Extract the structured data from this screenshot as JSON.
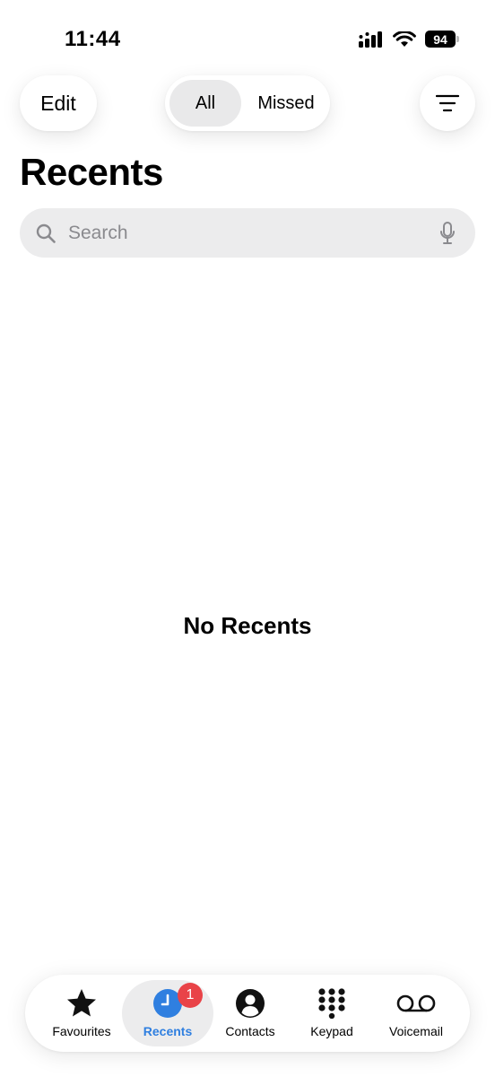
{
  "status_bar": {
    "time": "11:44",
    "battery_level": "94",
    "icons": [
      "signal-icon",
      "wifi-icon",
      "battery-icon"
    ]
  },
  "header": {
    "edit_label": "Edit",
    "segments": [
      {
        "label": "All",
        "selected": true
      },
      {
        "label": "Missed",
        "selected": false
      }
    ],
    "filter_icon": "filter-icon"
  },
  "page": {
    "title": "Recents",
    "empty_message": "No Recents"
  },
  "search": {
    "placeholder": "Search",
    "value": "",
    "icons": [
      "search-icon",
      "microphone-icon"
    ]
  },
  "tab_bar": {
    "active": "Recents",
    "items": [
      {
        "label": "Favourites",
        "icon": "star-icon"
      },
      {
        "label": "Recents",
        "icon": "clock-icon",
        "badge": "1"
      },
      {
        "label": "Contacts",
        "icon": "person-circle-icon"
      },
      {
        "label": "Keypad",
        "icon": "keypad-icon"
      },
      {
        "label": "Voicemail",
        "icon": "voicemail-icon"
      }
    ]
  },
  "colors": {
    "accent": "#2f7fe0",
    "badge": "#e94348",
    "segment_selected_bg": "#e9e9ea",
    "search_bg": "#ececed"
  }
}
